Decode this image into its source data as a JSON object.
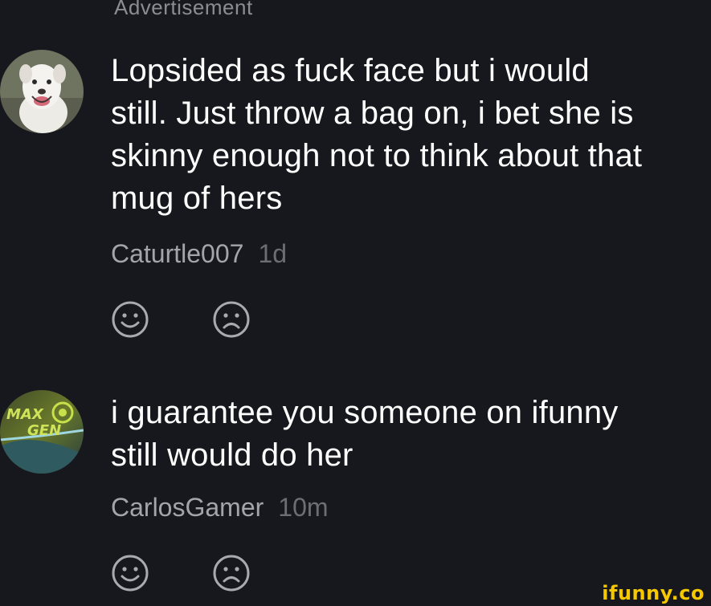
{
  "advertisement_label": "Advertisement",
  "comments": [
    {
      "text": "Lopsided as fuck face but i would\nstill. Just throw a bag on, i bet she is\nskinny enough not to think about that\nmug of hers",
      "username": "Caturtle007",
      "time": "1d",
      "avatar": "dog-avatar",
      "reactions": [
        "smile-icon",
        "frown-icon"
      ]
    },
    {
      "text": "i guarantee you someone on ifunny\nstill would do her",
      "username": "CarlosGamer",
      "time": "10m",
      "avatar": "max-gen-avatar",
      "avatar_lettering": "MAX GEN",
      "reactions": [
        "smile-icon",
        "frown-icon"
      ]
    }
  ],
  "watermark": "ifunny.co",
  "colors": {
    "background": "#17181d",
    "text": "#ffffff",
    "username": "#a4a5aa",
    "timestamp": "#6d6e73",
    "icon": "#a9aaaf",
    "watermark": "#f5c800"
  }
}
